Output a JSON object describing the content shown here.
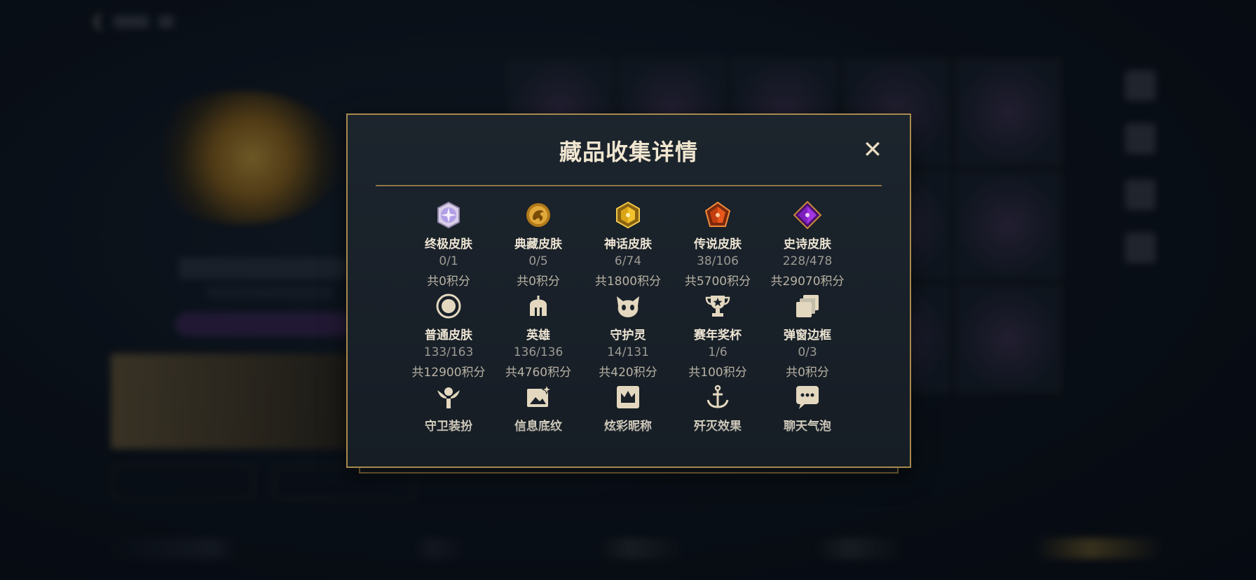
{
  "modal": {
    "title": "藏品收集详情",
    "close_label": "✕"
  },
  "collections": [
    {
      "name": "终极皮肤",
      "count": "0/1",
      "points": "共0积分",
      "icon": "ultimate-skin-gem-icon"
    },
    {
      "name": "典藏皮肤",
      "count": "0/5",
      "points": "共0积分",
      "icon": "prestige-dragon-icon"
    },
    {
      "name": "神话皮肤",
      "count": "6/74",
      "points": "共1800积分",
      "icon": "mythic-gem-icon"
    },
    {
      "name": "传说皮肤",
      "count": "38/106",
      "points": "共5700积分",
      "icon": "legendary-gem-icon"
    },
    {
      "name": "史诗皮肤",
      "count": "228/478",
      "points": "共29070积分",
      "icon": "epic-gem-icon"
    },
    {
      "name": "普通皮肤",
      "count": "133/163",
      "points": "共12900积分",
      "icon": "normal-skin-circle-icon"
    },
    {
      "name": "英雄",
      "count": "136/136",
      "points": "共4760积分",
      "icon": "helmet-icon"
    },
    {
      "name": "守护灵",
      "count": "14/131",
      "points": "共420积分",
      "icon": "guardian-creature-icon"
    },
    {
      "name": "赛年奖杯",
      "count": "1/6",
      "points": "共100积分",
      "icon": "trophy-icon"
    },
    {
      "name": "弹窗边框",
      "count": "0/3",
      "points": "共0积分",
      "icon": "stacked-frames-icon"
    },
    {
      "name": "守卫装扮",
      "icon": "ward-skin-icon"
    },
    {
      "name": "信息底纹",
      "icon": "info-banner-icon"
    },
    {
      "name": "炫彩昵称",
      "icon": "crown-nameplate-icon"
    },
    {
      "name": "歼灭效果",
      "icon": "anchor-icon"
    },
    {
      "name": "聊天气泡",
      "icon": "chat-bubble-icon"
    }
  ],
  "colors": {
    "gold": "#a88a4c",
    "ultimate": "#c9b8f0",
    "mythic": "#e5b21a",
    "legendary": "#e05a1e",
    "epic": "#9a2fd6"
  }
}
